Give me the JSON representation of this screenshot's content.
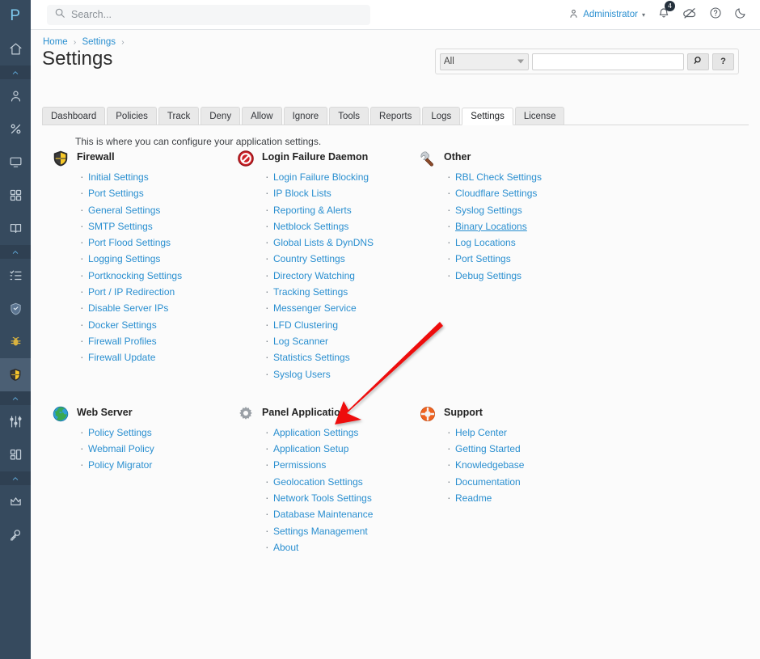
{
  "sidebar": {
    "logo": "P",
    "items": [
      {
        "name": "home-icon",
        "type": "icon"
      },
      {
        "name": "collapse-chevron-icon",
        "type": "sep"
      },
      {
        "name": "user-icon",
        "type": "icon"
      },
      {
        "name": "percent-icon",
        "type": "icon"
      },
      {
        "name": "monitor-icon",
        "type": "icon"
      },
      {
        "name": "grid-icon",
        "type": "icon"
      },
      {
        "name": "book-icon",
        "type": "icon"
      },
      {
        "name": "collapse-chevron-icon",
        "type": "sep"
      },
      {
        "name": "checklist-icon",
        "type": "icon"
      },
      {
        "name": "shield-icon",
        "type": "icon"
      },
      {
        "name": "bug-icon",
        "type": "icon"
      },
      {
        "name": "firewall-shield-icon",
        "type": "icon",
        "active": true
      },
      {
        "name": "collapse-chevron-icon",
        "type": "sep"
      },
      {
        "name": "sliders-icon",
        "type": "icon"
      },
      {
        "name": "layout-icon",
        "type": "icon"
      },
      {
        "name": "collapse-chevron-icon",
        "type": "sep"
      },
      {
        "name": "crown-icon",
        "type": "icon"
      },
      {
        "name": "key-icon",
        "type": "icon"
      }
    ],
    "expand_handle": "›"
  },
  "topbar": {
    "search_placeholder": "Search...",
    "search_value": "",
    "user": "Administrator",
    "user_caret": "⌄",
    "notification_count": "4",
    "icons": [
      "bell-icon",
      "cloud-off-icon",
      "help-circle-icon",
      "moon-icon"
    ]
  },
  "breadcrumb": {
    "items": [
      "Home",
      "Settings"
    ],
    "separator": "›",
    "trailing_separator": "›"
  },
  "page": {
    "title": "Settings",
    "intro": "This is where you can configure your application settings."
  },
  "panel_search": {
    "selected_option": "All",
    "options": [
      "All"
    ],
    "input_value": "",
    "search_button": "⚲",
    "help_button": "?"
  },
  "tabs": [
    {
      "label": "Dashboard",
      "active": false
    },
    {
      "label": "Policies",
      "active": false
    },
    {
      "label": "Track",
      "active": false
    },
    {
      "label": "Deny",
      "active": false
    },
    {
      "label": "Allow",
      "active": false
    },
    {
      "label": "Ignore",
      "active": false
    },
    {
      "label": "Tools",
      "active": false
    },
    {
      "label": "Reports",
      "active": false
    },
    {
      "label": "Logs",
      "active": false
    },
    {
      "label": "Settings",
      "active": true
    },
    {
      "label": "License",
      "active": false
    }
  ],
  "sections": [
    {
      "title": "Firewall",
      "icon": "shield-firewall-icon",
      "links": [
        "Initial Settings",
        "Port Settings",
        "General Settings",
        "SMTP Settings",
        "Port Flood Settings",
        "Logging Settings",
        "Portknocking Settings",
        "Port / IP Redirection",
        "Disable Server IPs",
        "Docker Settings",
        "Firewall Profiles",
        "Firewall Update"
      ]
    },
    {
      "title": "Login Failure Daemon",
      "icon": "no-entry-icon",
      "links": [
        "Login Failure Blocking",
        "IP Block Lists",
        "Reporting & Alerts",
        "Netblock Settings",
        "Global Lists & DynDNS",
        "Country Settings",
        "Directory Watching",
        "Tracking Settings",
        "Messenger Service",
        "LFD Clustering",
        "Log Scanner",
        "Statistics Settings",
        "Syslog Users"
      ]
    },
    {
      "title": "Other",
      "icon": "wrench-icon",
      "links": [
        "RBL Check Settings",
        "Cloudflare Settings",
        "Syslog Settings",
        "Binary Locations",
        "Log Locations",
        "Port Settings",
        "Debug Settings"
      ],
      "hover_link": "Binary Locations"
    },
    {
      "title": "Web Server",
      "icon": "globe-icon",
      "links": [
        "Policy Settings",
        "Webmail Policy",
        "Policy Migrator"
      ]
    },
    {
      "title": "Panel Application",
      "icon": "gear-icon",
      "links": [
        "Application Settings",
        "Application Setup",
        "Permissions",
        "Geolocation Settings",
        "Network Tools Settings",
        "Database Maintenance",
        "Settings Management",
        "About"
      ]
    },
    {
      "title": "Support",
      "icon": "lifebuoy-icon",
      "links": [
        "Help Center",
        "Getting Started",
        "Knowledgebase",
        "Documentation",
        "Readme"
      ]
    }
  ],
  "annotation": {
    "name": "red-arrow-annotation",
    "points_to": "Permissions",
    "color": "#ee1111"
  }
}
